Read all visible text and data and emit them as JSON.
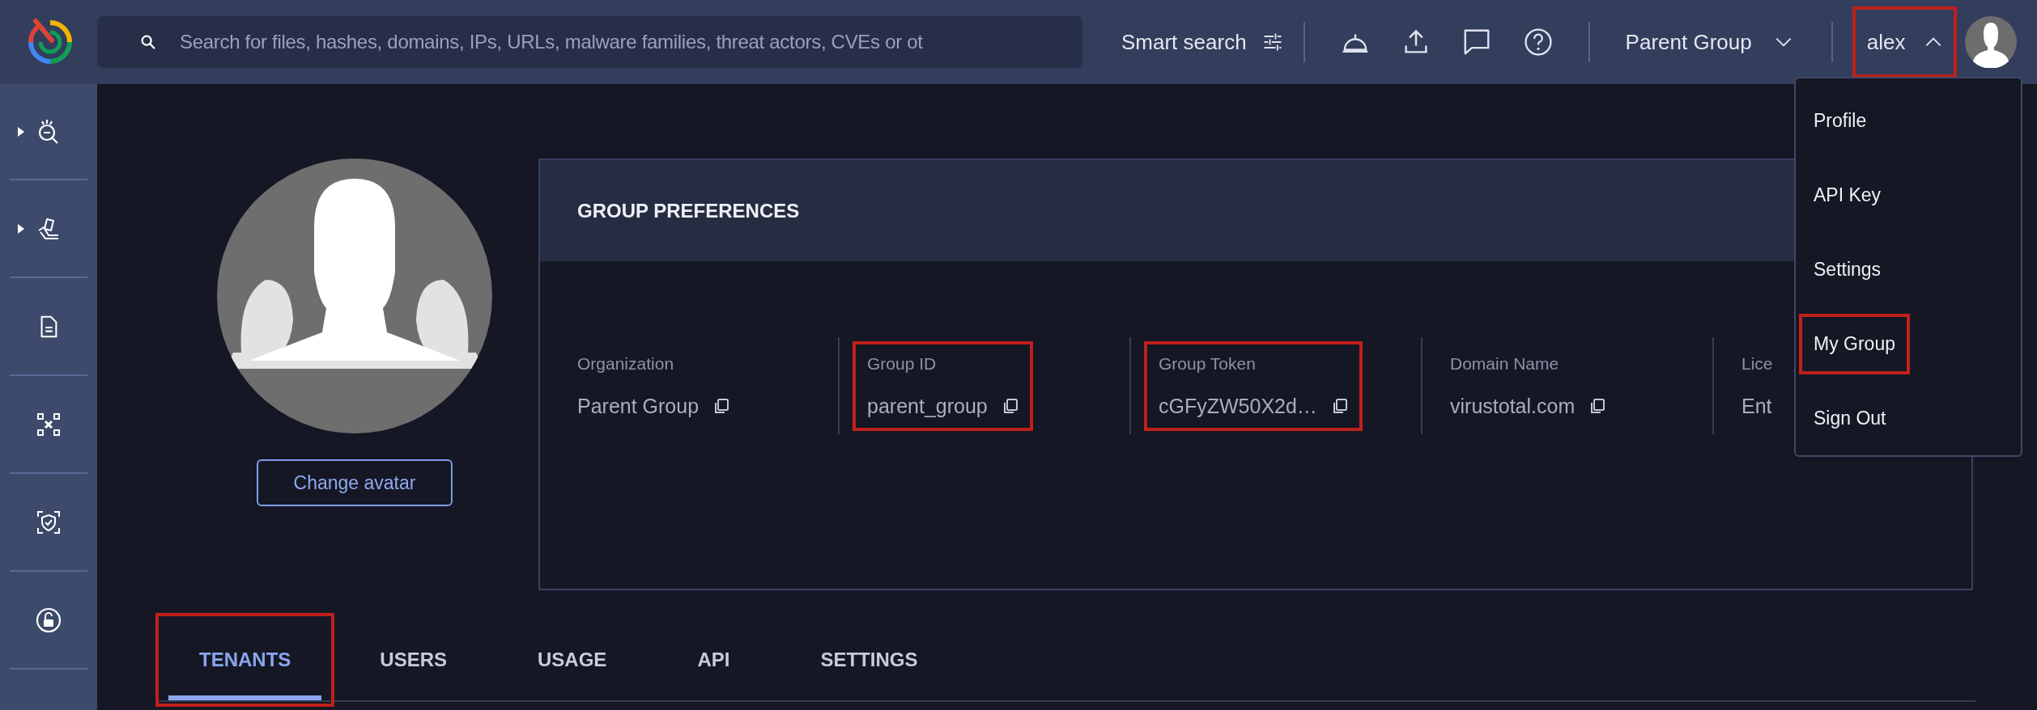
{
  "top_bar": {
    "search": {
      "placeholder": "Search for files, hashes, domains, IPs, URLs, malware families, threat actors, CVEs or ot"
    },
    "smart_search": "Smart search",
    "group_selector": "Parent Group",
    "user_menu": {
      "label": "alex",
      "expanded": true,
      "highlighted": true
    }
  },
  "sidebar": {
    "items": [
      {
        "has_submenu": true
      },
      {
        "has_submenu": true
      },
      {
        "has_submenu": false
      },
      {
        "has_submenu": false
      },
      {
        "has_submenu": false
      },
      {
        "has_submenu": false
      }
    ]
  },
  "group": {
    "avatar_button": "Change avatar",
    "preferences": {
      "title": "GROUP PREFERENCES",
      "fields": [
        {
          "label": "Organization",
          "value": "Parent Group",
          "copyable": true,
          "highlighted": false
        },
        {
          "label": "Group ID",
          "value": "parent_group",
          "copyable": true,
          "highlighted": true
        },
        {
          "label": "Group Token",
          "value": "cGFyZW50X2d…",
          "copyable": true,
          "highlighted": true
        },
        {
          "label": "Domain Name",
          "value": "virustotal.com",
          "copyable": true,
          "highlighted": false
        },
        {
          "label": "Lice",
          "value": "Ent",
          "copyable": false,
          "highlighted": false
        }
      ]
    }
  },
  "tabs": [
    {
      "label": "TENANTS",
      "selected": true,
      "highlighted": true
    },
    {
      "label": "USERS",
      "selected": false,
      "highlighted": false
    },
    {
      "label": "USAGE",
      "selected": false,
      "highlighted": false
    },
    {
      "label": "API",
      "selected": false,
      "highlighted": false
    },
    {
      "label": "SETTINGS",
      "selected": false,
      "highlighted": false
    }
  ],
  "user_dropdown": {
    "items": [
      {
        "label": "Profile",
        "highlighted": false
      },
      {
        "label": "API Key",
        "highlighted": false
      },
      {
        "label": "Settings",
        "highlighted": false
      },
      {
        "label": "My Group",
        "highlighted": true
      },
      {
        "label": "Sign Out",
        "highlighted": false
      }
    ]
  }
}
